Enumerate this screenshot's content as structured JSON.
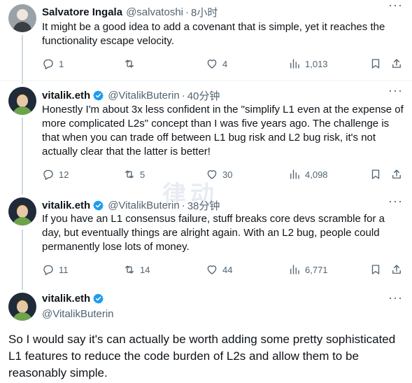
{
  "tweets": [
    {
      "name": "Salvatore Ingala",
      "handle": "@salvatoshi",
      "dot": "·",
      "time": "8小时",
      "text": "It might be a good idea to add a covenant that is simple, yet it reaches the functionality escape velocity.",
      "replies": "1",
      "retweets": "",
      "likes": "4",
      "views": "1,013"
    },
    {
      "name": "vitalik.eth",
      "handle": "@VitalikButerin",
      "dot": "·",
      "time": "40分钟",
      "text": "Honestly I'm about 3x less confident in the \"simplify L1 even at the expense of more complicated L2s\" concept than I was five years ago. The challenge is that when you can trade off between L1 bug risk and L2 bug risk, it's not actually clear that the latter is better!",
      "replies": "12",
      "retweets": "5",
      "likes": "30",
      "views": "4,098"
    },
    {
      "name": "vitalik.eth",
      "handle": "@VitalikButerin",
      "dot": "·",
      "time": "38分钟",
      "text": "If you have an L1 consensus failure, stuff breaks core devs scramble for a day, but eventually things are alright again. With an L2 bug, people could permanently lose lots of money.",
      "replies": "11",
      "retweets": "14",
      "likes": "44",
      "views": "6,771"
    }
  ],
  "main_tweet": {
    "name": "vitalik.eth",
    "handle": "@VitalikButerin",
    "text": "So I would say it's can actually be worth adding some pretty sophisticated L1 features to reduce the code burden of L2s and allow them to be reasonably simple."
  },
  "watermark": "律动",
  "colors": {
    "accent": "#1d9bf0",
    "secondary_text": "#536471",
    "thread_line": "#cfd9de"
  }
}
